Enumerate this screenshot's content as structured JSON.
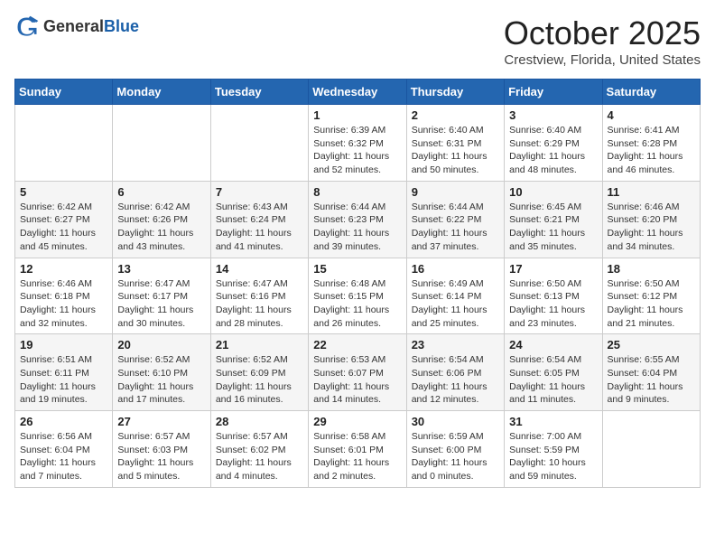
{
  "header": {
    "logo_general": "General",
    "logo_blue": "Blue",
    "month": "October 2025",
    "location": "Crestview, Florida, United States"
  },
  "weekdays": [
    "Sunday",
    "Monday",
    "Tuesday",
    "Wednesday",
    "Thursday",
    "Friday",
    "Saturday"
  ],
  "weeks": [
    [
      {
        "day": "",
        "info": ""
      },
      {
        "day": "",
        "info": ""
      },
      {
        "day": "",
        "info": ""
      },
      {
        "day": "1",
        "info": "Sunrise: 6:39 AM\nSunset: 6:32 PM\nDaylight: 11 hours\nand 52 minutes."
      },
      {
        "day": "2",
        "info": "Sunrise: 6:40 AM\nSunset: 6:31 PM\nDaylight: 11 hours\nand 50 minutes."
      },
      {
        "day": "3",
        "info": "Sunrise: 6:40 AM\nSunset: 6:29 PM\nDaylight: 11 hours\nand 48 minutes."
      },
      {
        "day": "4",
        "info": "Sunrise: 6:41 AM\nSunset: 6:28 PM\nDaylight: 11 hours\nand 46 minutes."
      }
    ],
    [
      {
        "day": "5",
        "info": "Sunrise: 6:42 AM\nSunset: 6:27 PM\nDaylight: 11 hours\nand 45 minutes."
      },
      {
        "day": "6",
        "info": "Sunrise: 6:42 AM\nSunset: 6:26 PM\nDaylight: 11 hours\nand 43 minutes."
      },
      {
        "day": "7",
        "info": "Sunrise: 6:43 AM\nSunset: 6:24 PM\nDaylight: 11 hours\nand 41 minutes."
      },
      {
        "day": "8",
        "info": "Sunrise: 6:44 AM\nSunset: 6:23 PM\nDaylight: 11 hours\nand 39 minutes."
      },
      {
        "day": "9",
        "info": "Sunrise: 6:44 AM\nSunset: 6:22 PM\nDaylight: 11 hours\nand 37 minutes."
      },
      {
        "day": "10",
        "info": "Sunrise: 6:45 AM\nSunset: 6:21 PM\nDaylight: 11 hours\nand 35 minutes."
      },
      {
        "day": "11",
        "info": "Sunrise: 6:46 AM\nSunset: 6:20 PM\nDaylight: 11 hours\nand 34 minutes."
      }
    ],
    [
      {
        "day": "12",
        "info": "Sunrise: 6:46 AM\nSunset: 6:18 PM\nDaylight: 11 hours\nand 32 minutes."
      },
      {
        "day": "13",
        "info": "Sunrise: 6:47 AM\nSunset: 6:17 PM\nDaylight: 11 hours\nand 30 minutes."
      },
      {
        "day": "14",
        "info": "Sunrise: 6:47 AM\nSunset: 6:16 PM\nDaylight: 11 hours\nand 28 minutes."
      },
      {
        "day": "15",
        "info": "Sunrise: 6:48 AM\nSunset: 6:15 PM\nDaylight: 11 hours\nand 26 minutes."
      },
      {
        "day": "16",
        "info": "Sunrise: 6:49 AM\nSunset: 6:14 PM\nDaylight: 11 hours\nand 25 minutes."
      },
      {
        "day": "17",
        "info": "Sunrise: 6:50 AM\nSunset: 6:13 PM\nDaylight: 11 hours\nand 23 minutes."
      },
      {
        "day": "18",
        "info": "Sunrise: 6:50 AM\nSunset: 6:12 PM\nDaylight: 11 hours\nand 21 minutes."
      }
    ],
    [
      {
        "day": "19",
        "info": "Sunrise: 6:51 AM\nSunset: 6:11 PM\nDaylight: 11 hours\nand 19 minutes."
      },
      {
        "day": "20",
        "info": "Sunrise: 6:52 AM\nSunset: 6:10 PM\nDaylight: 11 hours\nand 17 minutes."
      },
      {
        "day": "21",
        "info": "Sunrise: 6:52 AM\nSunset: 6:09 PM\nDaylight: 11 hours\nand 16 minutes."
      },
      {
        "day": "22",
        "info": "Sunrise: 6:53 AM\nSunset: 6:07 PM\nDaylight: 11 hours\nand 14 minutes."
      },
      {
        "day": "23",
        "info": "Sunrise: 6:54 AM\nSunset: 6:06 PM\nDaylight: 11 hours\nand 12 minutes."
      },
      {
        "day": "24",
        "info": "Sunrise: 6:54 AM\nSunset: 6:05 PM\nDaylight: 11 hours\nand 11 minutes."
      },
      {
        "day": "25",
        "info": "Sunrise: 6:55 AM\nSunset: 6:04 PM\nDaylight: 11 hours\nand 9 minutes."
      }
    ],
    [
      {
        "day": "26",
        "info": "Sunrise: 6:56 AM\nSunset: 6:04 PM\nDaylight: 11 hours\nand 7 minutes."
      },
      {
        "day": "27",
        "info": "Sunrise: 6:57 AM\nSunset: 6:03 PM\nDaylight: 11 hours\nand 5 minutes."
      },
      {
        "day": "28",
        "info": "Sunrise: 6:57 AM\nSunset: 6:02 PM\nDaylight: 11 hours\nand 4 minutes."
      },
      {
        "day": "29",
        "info": "Sunrise: 6:58 AM\nSunset: 6:01 PM\nDaylight: 11 hours\nand 2 minutes."
      },
      {
        "day": "30",
        "info": "Sunrise: 6:59 AM\nSunset: 6:00 PM\nDaylight: 11 hours\nand 0 minutes."
      },
      {
        "day": "31",
        "info": "Sunrise: 7:00 AM\nSunset: 5:59 PM\nDaylight: 10 hours\nand 59 minutes."
      },
      {
        "day": "",
        "info": ""
      }
    ]
  ]
}
